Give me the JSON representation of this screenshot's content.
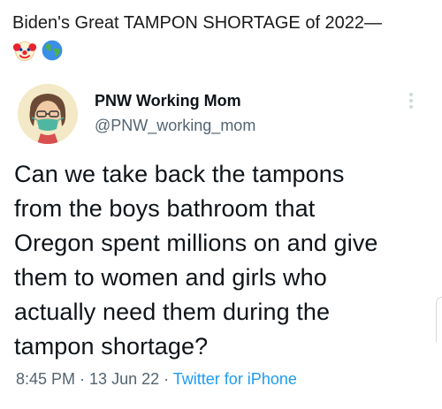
{
  "headline": "Biden's Great TAMPON SHORTAGE of 2022—",
  "headline_emojis": [
    "clown-face-emoji",
    "globe-emoji"
  ],
  "tweet": {
    "display_name": "PNW Working Mom",
    "handle": "@PNW_working_mom",
    "avatar_icon": "masked-woman-avatar",
    "more_icon": "vertical-ellipsis-icon",
    "text": "Can we take back the tampons\nfrom the boys bathroom that\nOregon spent millions on and give\nthem to women and girls who\nactually need them during the\ntampon shortage?",
    "time": "8:45 PM",
    "date": "13 Jun 22",
    "separator": " · ",
    "source": "Twitter for iPhone"
  },
  "colors": {
    "text_primary": "#0f1419",
    "text_secondary": "#536471",
    "link": "#1d9bf0"
  }
}
